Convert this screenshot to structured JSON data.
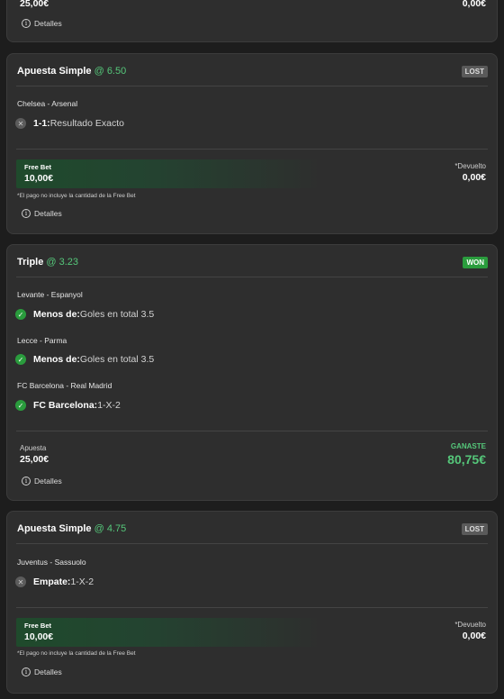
{
  "card0": {
    "stake_value": "25,00€",
    "return_value": "0,00€",
    "details_label": "Detalles"
  },
  "card1": {
    "bet_type": "Apuesta Simple",
    "odds": "@ 6.50",
    "status": "LOST",
    "match": "Chelsea - Arsenal",
    "selection": {
      "label": "1-1:",
      "market": "Resultado Exacto",
      "result_icon": "x-icon"
    },
    "free_bet_label": "Free Bet",
    "free_bet_value": "10,00€",
    "returned_label": "*Devuelto",
    "returned_value": "0,00€",
    "note": "*El pago no incluye la cantidad de la Free Bet",
    "details_label": "Detalles"
  },
  "card2": {
    "bet_type": "Triple",
    "odds": "@ 3.23",
    "status": "WON",
    "legs": [
      {
        "match": "Levante - Espanyol",
        "label": "Menos de:",
        "market": "Goles en total 3.5",
        "result_icon": "check-icon"
      },
      {
        "match": "Lecce - Parma",
        "label": "Menos de:",
        "market": "Goles en total 3.5",
        "result_icon": "check-icon"
      },
      {
        "match": "FC Barcelona - Real Madrid",
        "label": "FC Barcelona:",
        "market": "1-X-2",
        "result_icon": "check-icon"
      }
    ],
    "stake_label": "Apuesta",
    "stake_value": "25,00€",
    "won_label": "GANASTE",
    "won_value": "80,75€",
    "details_label": "Detalles"
  },
  "card3": {
    "bet_type": "Apuesta Simple",
    "odds": "@ 4.75",
    "status": "LOST",
    "match": "Juventus - Sassuolo",
    "selection": {
      "label": "Empate:",
      "market": "1-X-2",
      "result_icon": "x-icon"
    },
    "free_bet_label": "Free Bet",
    "free_bet_value": "10,00€",
    "returned_label": "*Devuelto",
    "returned_value": "0,00€",
    "note": "*El pago no incluye la cantidad de la Free Bet",
    "details_label": "Detalles"
  },
  "colors": {
    "accent_green": "#55c77a",
    "won_badge": "#2a9c3d",
    "lost_badge": "#5a5a5a",
    "card_bg": "#2e2e2e",
    "page_bg": "#1d1d1d"
  }
}
